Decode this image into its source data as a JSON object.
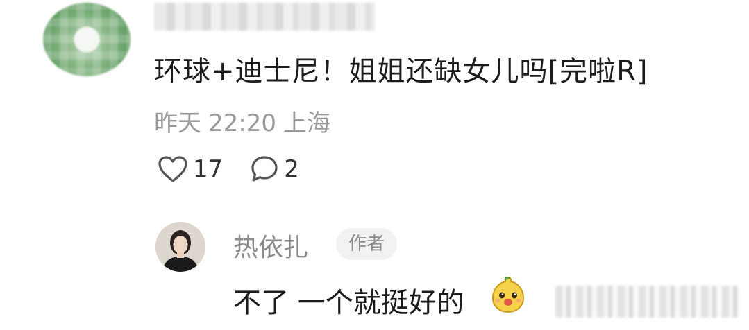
{
  "comment": {
    "text": "环球+迪士尼！姐姐还缺女儿吗[完啦R]",
    "meta": {
      "date": "昨天",
      "time": "22:20",
      "location": "上海"
    },
    "likes": "17",
    "replies": "2"
  },
  "reply": {
    "author_name": "热依扎",
    "author_badge": "作者",
    "text": "不了 一个就挺好的"
  },
  "icons": {
    "like": "heart-outline-icon",
    "reply": "speech-bubble-icon",
    "emoji": "yellow-mascot-emoji-icon"
  }
}
